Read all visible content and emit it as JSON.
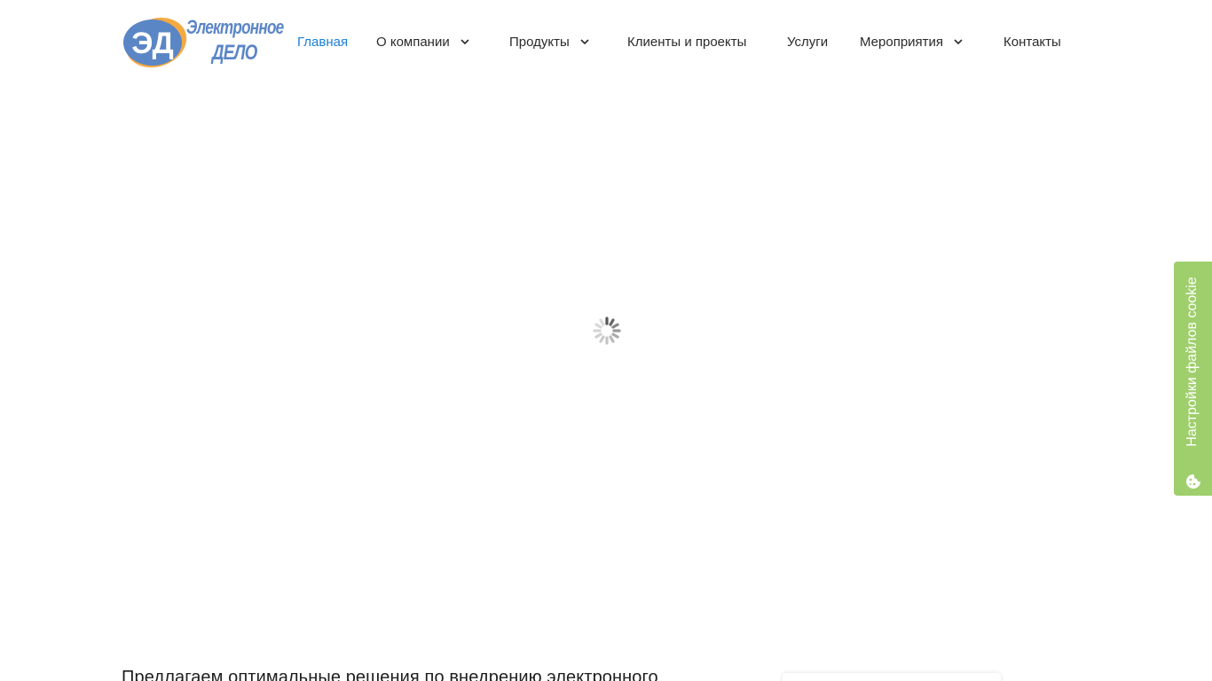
{
  "header": {
    "logo": {
      "mark_text": "ЭД",
      "line1": "Электронное",
      "line2": "ДЕЛО"
    },
    "nav": [
      {
        "label": "Главная",
        "active": true,
        "has_dropdown": false
      },
      {
        "label": "О компании",
        "active": false,
        "has_dropdown": true
      },
      {
        "label": "Продукты",
        "active": false,
        "has_dropdown": true
      },
      {
        "label": "Клиенты и проекты",
        "active": false,
        "has_dropdown": false
      },
      {
        "label": "Услуги",
        "active": false,
        "has_dropdown": false
      },
      {
        "label": "Мероприятия",
        "active": false,
        "has_dropdown": true
      },
      {
        "label": "Контакты",
        "active": false,
        "has_dropdown": false
      }
    ]
  },
  "loader": {
    "icon": "loading-spinner-icon"
  },
  "cookie_tab": {
    "label": "Настройки файлов cookie",
    "icon": "cookie-icon",
    "color": "#9fcf6c"
  },
  "main": {
    "intro_text": "Предлагаем оптимальные решения по внедрению электронного"
  },
  "colors": {
    "accent": "#1b7fd6",
    "logo_blue": "#5b86c6",
    "logo_orange": "#f6a940"
  }
}
